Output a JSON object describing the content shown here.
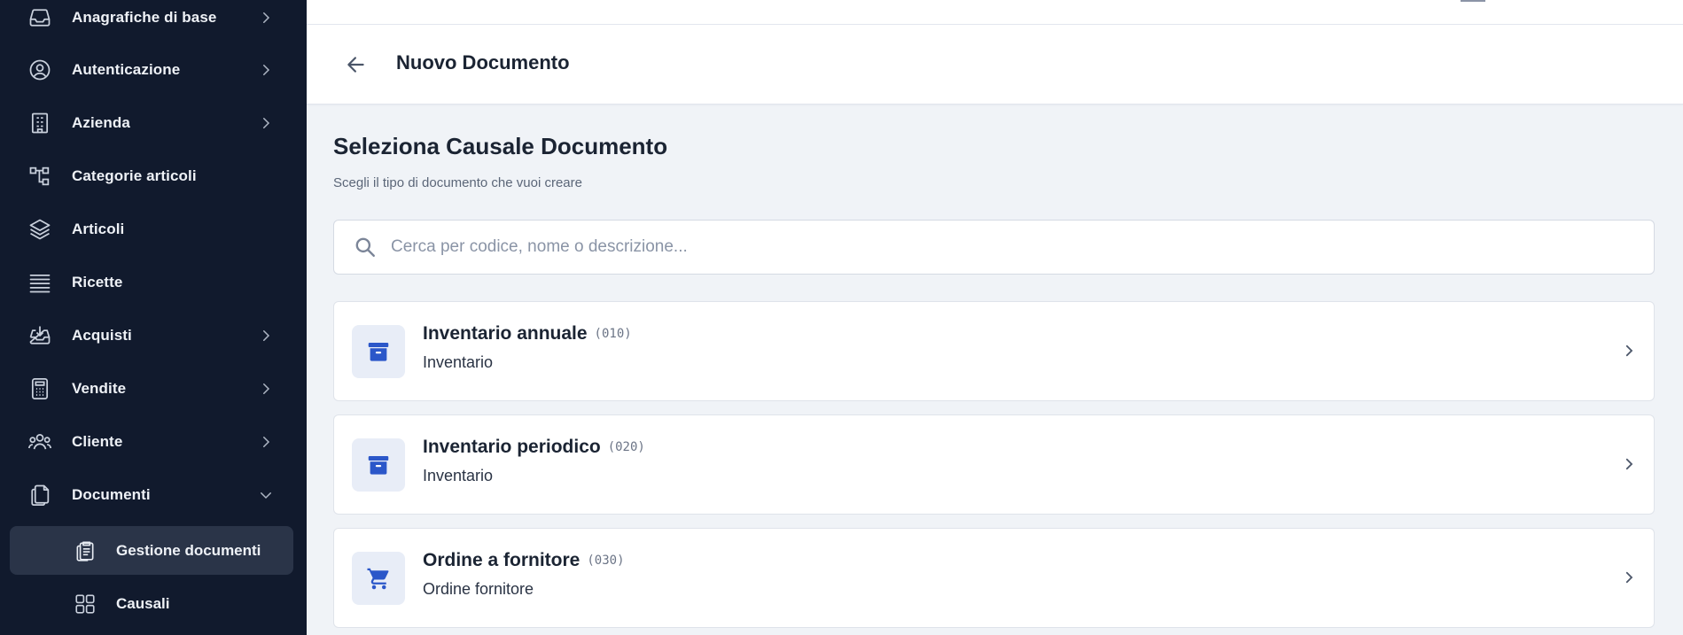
{
  "sidebar": {
    "items": [
      {
        "label": "Anagrafiche di base",
        "icon": "inbox-icon",
        "has_chevron": true
      },
      {
        "label": "Autenticazione",
        "icon": "user-circle-icon",
        "has_chevron": true
      },
      {
        "label": "Azienda",
        "icon": "building-icon",
        "has_chevron": true
      },
      {
        "label": "Categorie articoli",
        "icon": "hierarchy-icon",
        "has_chevron": false
      },
      {
        "label": "Articoli",
        "icon": "layers-icon",
        "has_chevron": false
      },
      {
        "label": "Ricette",
        "icon": "list-lines-icon",
        "has_chevron": false
      },
      {
        "label": "Acquisti",
        "icon": "tray-download-icon",
        "has_chevron": true
      },
      {
        "label": "Vendite",
        "icon": "calculator-icon",
        "has_chevron": true
      },
      {
        "label": "Cliente",
        "icon": "users-group-icon",
        "has_chevron": true
      },
      {
        "label": "Documenti",
        "icon": "documents-icon",
        "has_chevron": true,
        "expanded": true
      }
    ],
    "subitems": [
      {
        "label": "Gestione documenti",
        "icon": "clipboard-list-icon",
        "active": true
      },
      {
        "label": "Causali",
        "icon": "grid-squares-icon",
        "active": false
      }
    ]
  },
  "header": {
    "title": "Nuovo Documento",
    "back_icon": "arrow-left-icon"
  },
  "main": {
    "title": "Seleziona Causale Documento",
    "subtitle": "Scegli il tipo di documento che vuoi creare",
    "search": {
      "placeholder": "Cerca per codice, nome o descrizione...",
      "value": ""
    },
    "cards": [
      {
        "title": "Inventario annuale",
        "code": "(010)",
        "subtitle": "Inventario",
        "icon": "archive-box-icon"
      },
      {
        "title": "Inventario periodico",
        "code": "(020)",
        "subtitle": "Inventario",
        "icon": "archive-box-icon"
      },
      {
        "title": "Ordine a fornitore",
        "code": "(030)",
        "subtitle": "Ordine fornitore",
        "icon": "shopping-cart-icon"
      }
    ]
  },
  "colors": {
    "sidebar_bg": "#111a2d",
    "sidebar_active": "#2a3448",
    "accent": "#2b57c9",
    "page_bg": "#f0f3f7"
  }
}
